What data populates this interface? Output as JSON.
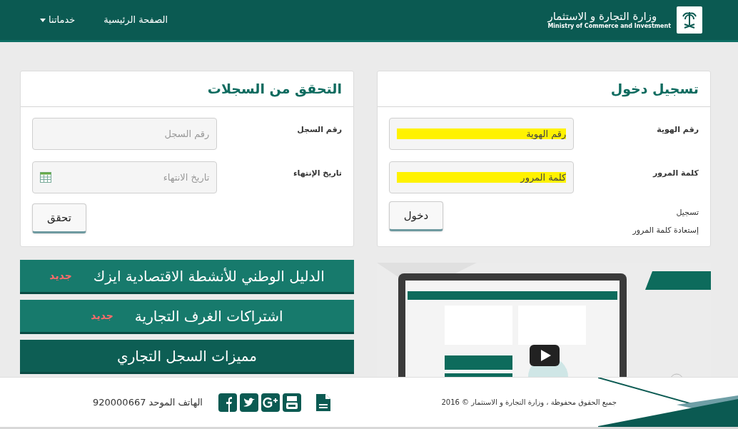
{
  "header": {
    "logo": {
      "title": "وزارة التجارة و الاستثمار",
      "subtitle": "Ministry of Commerce and Investment"
    },
    "nav": [
      {
        "label": "الصفحة الرئيسية",
        "kind": "link"
      },
      {
        "label": "خدماتنا",
        "kind": "dropdown"
      }
    ]
  },
  "login": {
    "title": "تسجيل دخول",
    "fields": [
      {
        "label": "رقم الهوية",
        "placeholder": "رقم الهوية",
        "highlighted": true
      },
      {
        "label": "كلمة المرور",
        "placeholder": "كلمة المرور",
        "highlighted": true
      }
    ],
    "button": "دخول",
    "links": [
      "تسجيل",
      "إستعادة كلمة المرور"
    ]
  },
  "verify": {
    "title": "التحقق من السجلات",
    "fields": [
      {
        "label": "رقم السجل",
        "placeholder": "رقم السجل",
        "kind": "text"
      },
      {
        "label": "تاريخ الإنتهاء",
        "placeholder": "تاريخ الانتهاء",
        "kind": "date"
      }
    ],
    "button": "تحقق"
  },
  "services": [
    {
      "label": "الدليل الوطني للأنشطة الاقتصادية ايزك",
      "badge": "جديد",
      "color": "#177a6c"
    },
    {
      "label": "اشتراكات الغرف التجارية",
      "badge": "جديد",
      "color": "#177a6c"
    },
    {
      "label": "مميزات السجل التجاري",
      "color": "#0d5e54"
    }
  ],
  "footer": {
    "phone": "الهاتف الموحد 920000667",
    "copyright": "جميع الحقوق محفوظة ، وزارة التجارة و الاستثمار © 2016"
  }
}
